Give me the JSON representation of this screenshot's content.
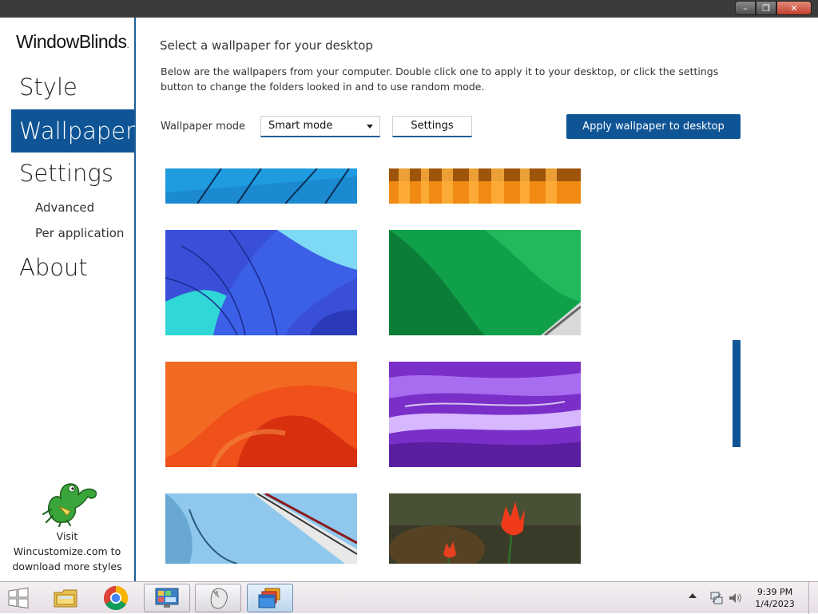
{
  "titlebar": {
    "min_label": "–",
    "max_label": "❐",
    "close_label": "✕"
  },
  "sidebar": {
    "logo_window": "Window",
    "logo_blinds": "Blinds",
    "logo_mark": ".",
    "items": [
      {
        "label": "Style"
      },
      {
        "label": "Wallpaper"
      },
      {
        "label": "Settings"
      },
      {
        "label": "About"
      }
    ],
    "sub_items": [
      {
        "label": "Advanced"
      },
      {
        "label": "Per application"
      }
    ],
    "promo": {
      "line1": "Visit",
      "line2": "Wincustomize.com to",
      "line3": "download more styles"
    }
  },
  "main": {
    "heading": "Select a wallpaper for your desktop",
    "description_line1": "Below are the wallpapers from your computer.  Double click one to apply it to your desktop, or click the settings",
    "description_line2": "button to change the folders looked in and to use random mode.",
    "mode_label": "Wallpaper mode",
    "mode_value": "Smart mode",
    "settings_button": "Settings",
    "apply_button": "Apply wallpaper to desktop"
  },
  "colors": {
    "accent": "#0f5596",
    "titlebar": "#3b3b3b"
  },
  "taskbar": {
    "icons": [
      "windows-start-icon",
      "file-explorer-icon",
      "chrome-icon",
      "control-panel-icon",
      "mouse-icon",
      "windowblinds-icon"
    ],
    "clock_time": "9:39 PM",
    "clock_date": "1/4/2023"
  }
}
